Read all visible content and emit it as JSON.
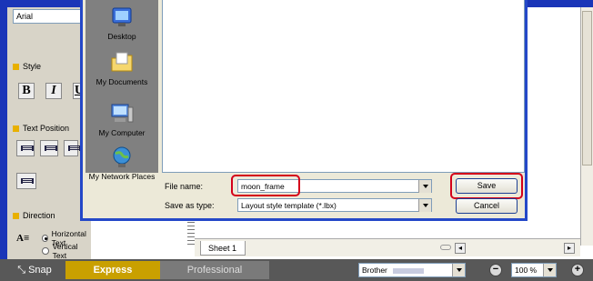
{
  "left_panel": {
    "font_value": "Arial",
    "style_label": "Style",
    "style_buttons": [
      "B",
      "I",
      "U"
    ],
    "text_position_label": "Text Position",
    "direction_label": "Direction",
    "direction_icon": "A≡",
    "direction_options": [
      "Horizontal Text",
      "Vertical Text"
    ],
    "direction_selected": "Horizontal Text"
  },
  "dialog": {
    "places": [
      "Desktop",
      "My Documents",
      "My Computer",
      "My Network Places"
    ],
    "file_name_label": "File name:",
    "file_name_value": "moon_frame",
    "save_as_type_label": "Save as type:",
    "save_as_type_value": "Layout style template (*.lbx)",
    "save_button": "Save",
    "cancel_button": "Cancel"
  },
  "workspace": {
    "sheet_tab": "Sheet 1"
  },
  "statusbar": {
    "snap_label": "Snap",
    "modes": [
      "Express",
      "Professional"
    ],
    "active_mode": "Express",
    "printer_value": "Brother",
    "zoom_value": "100 %",
    "zoom_out": "−",
    "zoom_in": "+"
  },
  "colors": {
    "accent_blue": "#1a35b8",
    "highlight_red": "#d4001a",
    "express_gold": "#c9a000"
  }
}
